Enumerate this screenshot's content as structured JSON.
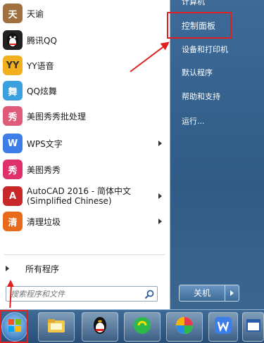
{
  "start_menu": {
    "programs": [
      {
        "label": "天谕",
        "icon": "tianyu-icon",
        "color": "#a07040",
        "arrow": false
      },
      {
        "label": "腾讯QQ",
        "icon": "qq-penguin-icon",
        "color": "#222222",
        "arrow": false
      },
      {
        "label": "YY语音",
        "icon": "yy-voice-icon",
        "color": "#f2b01e",
        "arrow": false
      },
      {
        "label": "QQ炫舞",
        "icon": "qq-dance-icon",
        "color": "#3aa0e0",
        "arrow": false
      },
      {
        "label": "美图秀秀批处理",
        "icon": "meitu-batch-icon",
        "color": "#e05a7a",
        "arrow": false
      },
      {
        "label": "WPS文字",
        "icon": "wps-writer-icon",
        "color": "#3c7de8",
        "arrow": true
      },
      {
        "label": "美图秀秀",
        "icon": "meitu-icon",
        "color": "#e0306a",
        "arrow": false
      },
      {
        "label": "AutoCAD 2016 - 简体中文",
        "label2": "(Simplified Chinese)",
        "icon": "autocad-icon",
        "color": "#c8282a",
        "arrow": true
      },
      {
        "label": "清理垃圾",
        "icon": "cleanup-icon",
        "color": "#e86a1a",
        "arrow": true
      }
    ],
    "all_programs": "所有程序",
    "search_placeholder": "搜索程序和文件",
    "right_items": {
      "computer": "计算机",
      "control_panel": "控制面板",
      "devices_printers": "设备和打印机",
      "default_programs": "默认程序",
      "help_support": "帮助和支持",
      "run": "运行..."
    },
    "shutdown": "关机"
  },
  "taskbar": {
    "buttons": [
      "windows-start-icon",
      "file-explorer-icon",
      "qq-taskbar-icon",
      "green-app-icon",
      "colorful-app-icon",
      "wps-taskbar-icon",
      "window-app-icon"
    ]
  },
  "annotation_color": "#e02020"
}
